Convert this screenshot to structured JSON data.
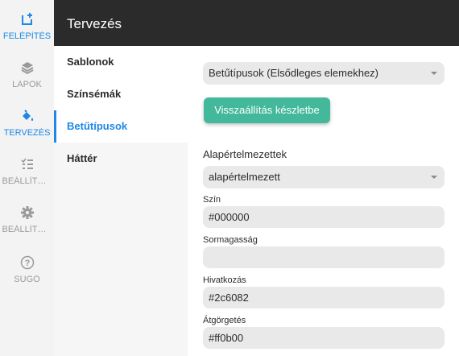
{
  "colors": {
    "accent": "#1e88e5",
    "header_bg": "#2b2b2b",
    "button_bg": "#43b89a",
    "rail_bg": "#f3f3f3",
    "field_bg": "#e9e9e9"
  },
  "rail": {
    "items": [
      {
        "label": "FELÉPÍTÉS",
        "icon": "add-box-icon",
        "active": true
      },
      {
        "label": "LAPOK",
        "icon": "layers-icon",
        "active": false
      },
      {
        "label": "TERVEZÉS",
        "icon": "paint-bucket-icon",
        "active": true
      },
      {
        "label": "BEÁLLÍTÁS...",
        "icon": "checklist-icon",
        "active": false
      },
      {
        "label": "BEÁLLÍTÁS...",
        "icon": "gear-icon",
        "active": false
      },
      {
        "label": "SÚGÓ",
        "icon": "help-icon",
        "active": false
      }
    ]
  },
  "header": {
    "title": "Tervezés"
  },
  "subnav": {
    "items": [
      {
        "label": "Sablonok",
        "active": false
      },
      {
        "label": "Színsémák",
        "active": false
      },
      {
        "label": "Betűtípusok",
        "active": true
      },
      {
        "label": "Háttér",
        "active": false
      }
    ]
  },
  "main": {
    "font_select": "Betűtípusok (Elsődleges elemekhez)",
    "reset_button": "Visszaállítás készletbe",
    "defaults_label": "Alapértelmezettek",
    "defaults_select": "alapértelmezett",
    "fields": [
      {
        "label": "Szín",
        "value": "#000000"
      },
      {
        "label": "Sormagasság",
        "value": ""
      },
      {
        "label": "Hivatkozás",
        "value": "#2c6082"
      },
      {
        "label": "Átgörgetés",
        "value": "#ff0b00"
      }
    ]
  }
}
